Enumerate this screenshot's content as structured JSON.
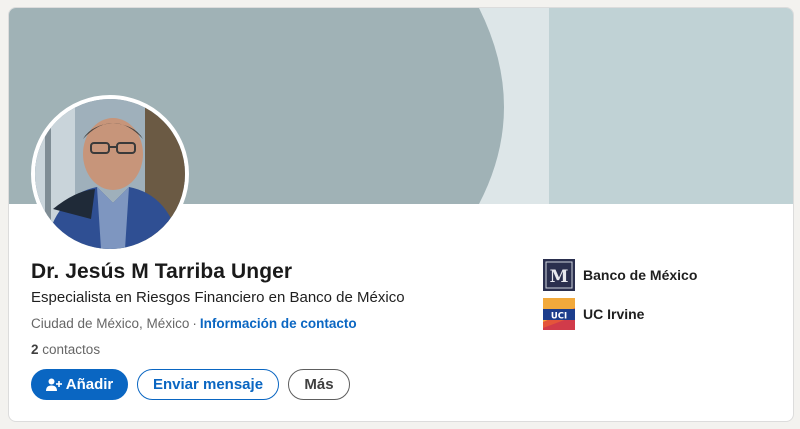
{
  "profile": {
    "name": "Dr. Jesús M Tarriba Unger",
    "headline": "Especialista en Riesgos Financiero en Banco de México",
    "location": "Ciudad de México, México",
    "separator": "·",
    "contact_info_label": "Información de contacto",
    "connections_count": "2",
    "connections_label": "contactos"
  },
  "actions": {
    "connect_label": "Añadir",
    "message_label": "Enviar mensaje",
    "more_label": "Más"
  },
  "organizations": [
    {
      "name": "Banco de México",
      "logo_text": "M",
      "icon": "banco-de-mexico-logo"
    },
    {
      "name": "UC Irvine",
      "logo_text": "UCI",
      "icon": "uc-irvine-logo"
    }
  ],
  "colors": {
    "accent": "#0a66c2",
    "banner_dark": "#a0b2b6",
    "banner_light": "#dde6e8",
    "banner_right": "#c0d2d5"
  }
}
